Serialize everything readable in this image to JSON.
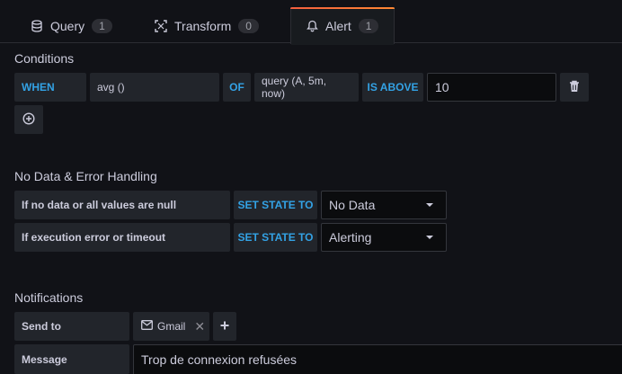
{
  "tabs": [
    {
      "label": "Query",
      "count": "1",
      "icon": "database-icon"
    },
    {
      "label": "Transform",
      "count": "0",
      "icon": "transform-icon"
    },
    {
      "label": "Alert",
      "count": "1",
      "icon": "bell-icon",
      "active": true
    }
  ],
  "conditions": {
    "heading": "Conditions",
    "when": "WHEN",
    "reducer": "avg ()",
    "of": "OF",
    "query": "query (A, 5m, now)",
    "evaluator": "IS ABOVE",
    "threshold": "10"
  },
  "no_data": {
    "heading": "No Data & Error Handling",
    "row1_label": "If no data or all values are null",
    "row1_action": "SET STATE TO",
    "row1_value": "No Data",
    "row2_label": "If execution error or timeout",
    "row2_action": "SET STATE TO",
    "row2_value": "Alerting"
  },
  "notifications": {
    "heading": "Notifications",
    "send_to_label": "Send to",
    "channel": "Gmail",
    "message_label": "Message",
    "message": "Trop de connexion refusées"
  },
  "colors": {
    "background": "#111217",
    "keyword": "#33a2e5",
    "active_tab_accent": "#ff8833"
  }
}
